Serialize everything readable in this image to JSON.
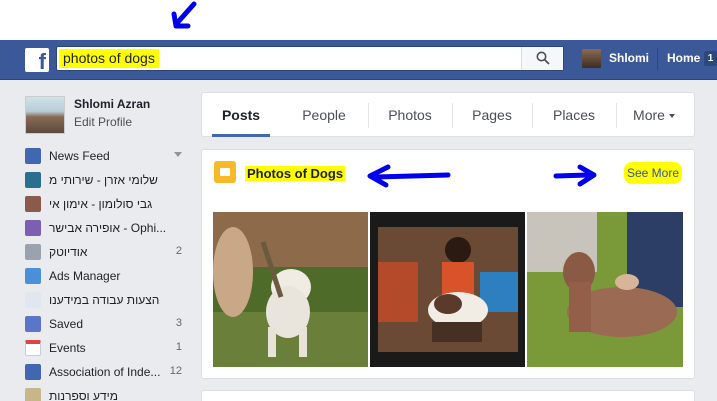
{
  "search": {
    "value": "photos of dogs"
  },
  "nav": {
    "user_name": "Shlomi",
    "home_label": "Home",
    "home_badge": "1"
  },
  "profile": {
    "name": "Shlomi Azran",
    "edit_label": "Edit Profile"
  },
  "sidebar": {
    "items": [
      {
        "label": "News Feed",
        "icon": "news-feed-icon",
        "count": ""
      },
      {
        "label": "שלומי אזרן - שירותי מ",
        "icon": "page-icon",
        "count": ""
      },
      {
        "label": "גבי סולומון - אימון אי",
        "icon": "page-icon",
        "count": ""
      },
      {
        "label": "אופירה אבישר - Ophi...",
        "icon": "page-icon",
        "count": ""
      },
      {
        "label": "אודיוטק",
        "icon": "speaker-icon",
        "count": "2"
      },
      {
        "label": "Ads Manager",
        "icon": "chart-icon",
        "count": ""
      },
      {
        "label": "הצעות עבודה במידענו",
        "icon": "lightbulb-icon",
        "count": ""
      },
      {
        "label": "Saved",
        "icon": "bookmark-icon",
        "count": "3"
      },
      {
        "label": "Events",
        "icon": "calendar-icon",
        "count": "1"
      },
      {
        "label": "Association of Inde...",
        "icon": "group-icon",
        "count": "12"
      },
      {
        "label": "מידע וספרנות",
        "icon": "book-icon",
        "count": ""
      }
    ]
  },
  "tabs": [
    "Posts",
    "People",
    "Photos",
    "Pages",
    "Places",
    "More"
  ],
  "results": {
    "section_title": "Photos of Dogs",
    "see_more": "See More"
  },
  "colors": {
    "brand": "#3b5998",
    "highlight": "#ffff00",
    "annotation": "#0000ee"
  }
}
